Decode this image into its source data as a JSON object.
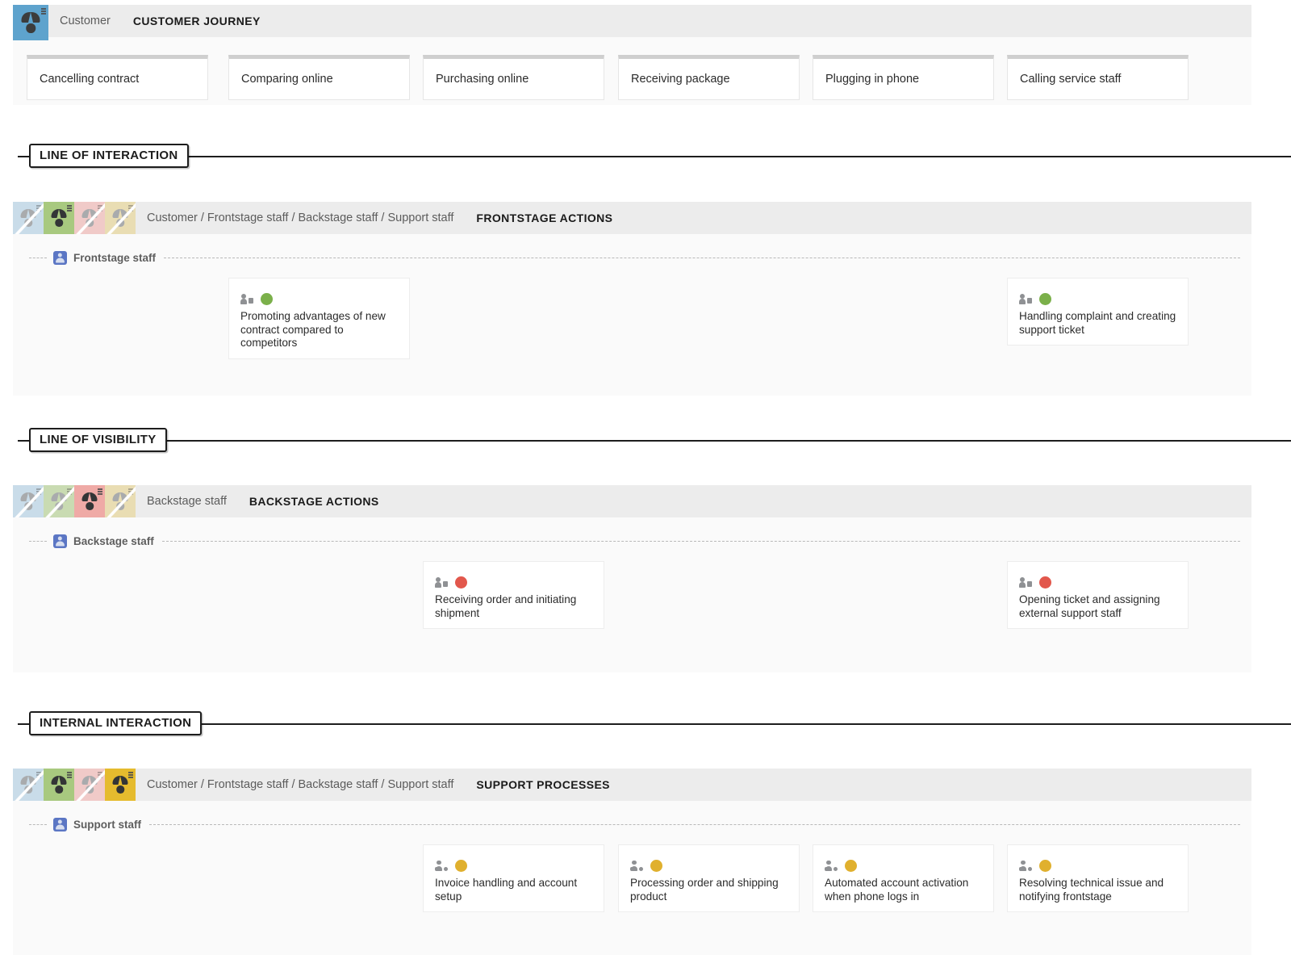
{
  "colors": {
    "customer_tile": "#a9cbe3",
    "frontstage_tile": "#a8c97f",
    "backstage_tile": "#efaaa6",
    "support_tile": "#e3cc81",
    "frontstage_dot": "#7bb04a",
    "backstage_dot": "#e2574c",
    "support_dot": "#e0b02e",
    "lane_icon": "#5b76c4",
    "band_header": "#ececec",
    "band_body": "#fafafa",
    "stage_top_bar": "#cfcfcf"
  },
  "journey": {
    "avatar_name": "customer-avatar",
    "role_label": "Customer",
    "section_title": "CUSTOMER JOURNEY",
    "stages": [
      {
        "label": "Cancelling contract"
      },
      {
        "label": "Comparing online"
      },
      {
        "label": "Purchasing online"
      },
      {
        "label": "Receiving package"
      },
      {
        "label": "Plugging in phone"
      },
      {
        "label": "Calling service staff"
      }
    ]
  },
  "dividers": [
    {
      "label": "LINE OF INTERACTION"
    },
    {
      "label": "LINE OF VISIBILITY"
    },
    {
      "label": "INTERNAL INTERACTION"
    }
  ],
  "frontstage": {
    "role_label": "Customer / Frontstage staff / Backstage staff / Support staff",
    "section_title": "FRONTSTAGE ACTIONS",
    "lane_label": "Frontstage staff",
    "active_avatar_index": 1,
    "cards": [
      {
        "column": 1,
        "text": "Promoting advantages of new contract compared to competitors",
        "dot": "frontstage_dot",
        "icon": "person-badge-icon"
      },
      {
        "column": 5,
        "text": "Handling complaint and creating support ticket",
        "dot": "frontstage_dot",
        "icon": "person-badge-icon"
      }
    ]
  },
  "backstage": {
    "role_label": "Backstage staff",
    "section_title": "BACKSTAGE ACTIONS",
    "lane_label": "Backstage staff",
    "active_avatar_index": 2,
    "cards": [
      {
        "column": 2,
        "text": "Receiving order and initiating shipment",
        "dot": "backstage_dot",
        "icon": "person-badge-icon"
      },
      {
        "column": 5,
        "text": "Opening ticket and assigning external support staff",
        "dot": "backstage_dot",
        "icon": "person-badge-icon"
      }
    ]
  },
  "support": {
    "role_label": "Customer / Frontstage staff / Backstage staff / Support staff",
    "section_title": "SUPPORT PROCESSES",
    "lane_label": "Support staff",
    "active_avatar_index": 3,
    "cards": [
      {
        "column": 2,
        "text": "Invoice handling and account setup",
        "dot": "support_dot",
        "icon": "people-group-icon"
      },
      {
        "column": 3,
        "text": "Processing order and shipping product",
        "dot": "support_dot",
        "icon": "people-group-icon"
      },
      {
        "column": 4,
        "text": "Automated account activation when phone logs in",
        "dot": "support_dot",
        "icon": "people-group-icon"
      },
      {
        "column": 5,
        "text": "Resolving technical issue and notifying frontstage",
        "dot": "support_dot",
        "icon": "people-group-icon"
      }
    ]
  },
  "avatar_roles": [
    "Customer",
    "Frontstage staff",
    "Backstage staff",
    "Support staff"
  ]
}
